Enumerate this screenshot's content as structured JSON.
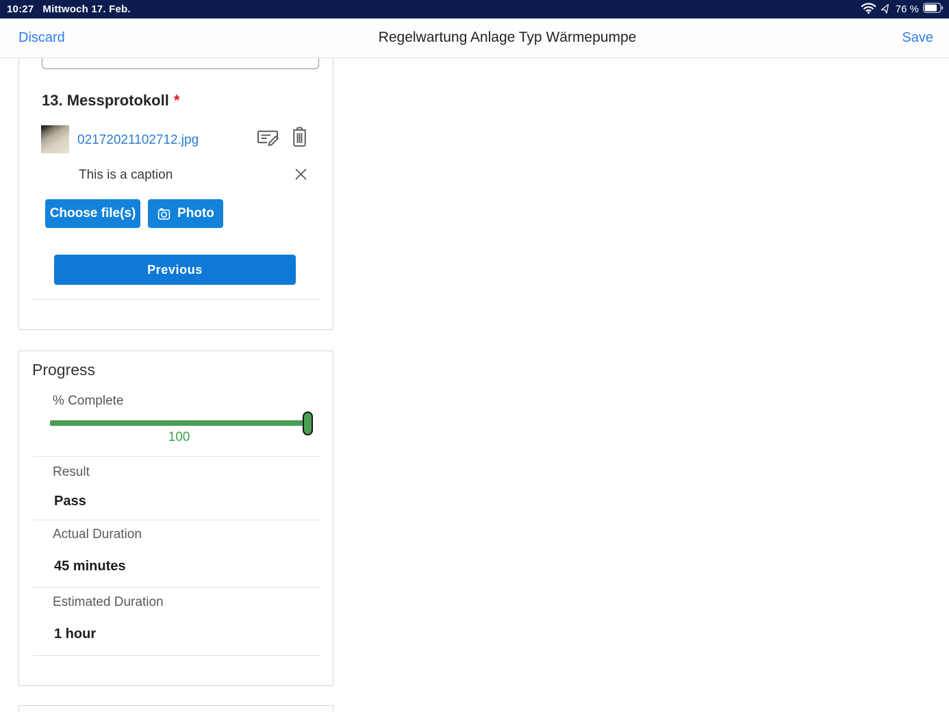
{
  "status_bar": {
    "time": "10:27",
    "date": "Mittwoch 17. Feb.",
    "battery_percent": "76 %"
  },
  "nav": {
    "discard_label": "Discard",
    "title": "Regelwartung Anlage Typ Wärmepumpe",
    "save_label": "Save"
  },
  "section": {
    "heading": "13. Messprotokoll",
    "required_marker": "*",
    "attachment": {
      "filename": "02172021102712.jpg",
      "caption": "This is a caption"
    },
    "buttons": {
      "choose_files": "Choose file(s)",
      "photo": "Photo",
      "previous": "Previous"
    }
  },
  "progress": {
    "title": "Progress",
    "percent_label": "% Complete",
    "percent_value": "100",
    "rows": [
      {
        "label": "Result",
        "value": "Pass"
      },
      {
        "label": "Actual Duration",
        "value": "45 minutes"
      },
      {
        "label": "Estimated Duration",
        "value": "1 hour"
      }
    ]
  },
  "colors": {
    "statusbar_navy": "#0d1c4e",
    "nav_link_blue": "#2e7cf0",
    "accent_button_blue": "#1282da",
    "file_link_blue": "#2b7cd3",
    "slider_green": "#4a9e52",
    "value_green": "#3fa14a",
    "required_red": "#e3131d"
  }
}
